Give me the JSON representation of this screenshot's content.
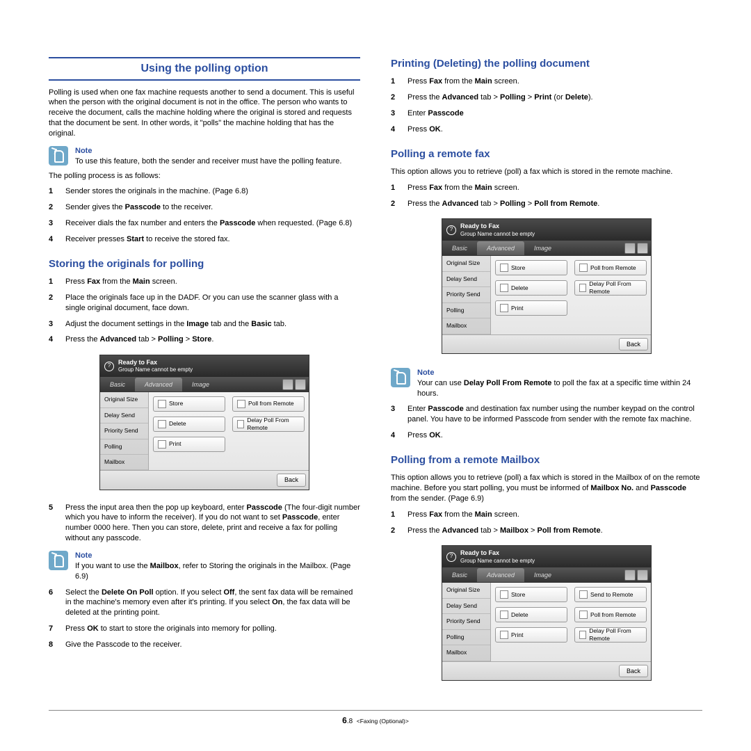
{
  "left": {
    "h1": "Using the polling option",
    "intro": "Polling is used when one fax machine requests another to send a document. This is useful when the person with the original document is not in the office. The person who wants to receive the document, calls the machine holding where the original is stored and requests that the document be sent. In other words, it \"polls\" the machine holding that has the original.",
    "note1_hd": "Note",
    "note1_txt": "To use this feature, both the sender and receiver must have the polling feature.",
    "process_intro": "The polling process is as follows:",
    "proc": {
      "n1": "1",
      "t1_a": "Sender stores the originals in the machine. (Page 6.8)",
      "n2": "2",
      "t2_a": "Sender gives the ",
      "t2_b": "Passcode",
      "t2_c": " to the receiver.",
      "n3": "3",
      "t3_a": "Receiver dials the fax number and enters the ",
      "t3_b": "Passcode",
      "t3_c": " when requested. (Page 6.8)",
      "n4": "4",
      "t4_a": "Receiver presses ",
      "t4_b": "Start",
      "t4_c": " to receive the stored fax."
    },
    "h2a": "Storing the originals for polling",
    "store": {
      "n1": "1",
      "t1_a": "Press ",
      "t1_b": "Fax",
      "t1_c": " from the ",
      "t1_d": "Main",
      "t1_e": " screen.",
      "n2": "2",
      "t2": "Place the originals face up in the DADF. Or you can use the scanner glass with a single original document, face down.",
      "n3": "3",
      "t3_a": "Adjust the document settings in the ",
      "t3_b": "Image",
      "t3_c": " tab and the ",
      "t3_d": "Basic",
      "t3_e": " tab.",
      "n4": "4",
      "t4_a": "Press the ",
      "t4_b": "Advanced",
      "t4_c": " tab > ",
      "t4_d": "Polling",
      "t4_e": " > ",
      "t4_f": "Store",
      "t4_g": ".",
      "n5": "5",
      "t5_a": "Press the input area then the pop up keyboard, enter ",
      "t5_b": "Passcode",
      "t5_c": " (The four-digit number which you have to inform the receiver). If you do not want to set ",
      "t5_d": "Passcode",
      "t5_e": ", enter number 0000 here. Then you can store, delete, print and receive a fax for polling without any passcode.",
      "n6": "6",
      "t6_a": "Select the ",
      "t6_b": "Delete On Poll",
      "t6_c": " option. If you select ",
      "t6_d": "Off",
      "t6_e": ", the sent fax data will be remained in the machine's memory even after it's printing. If you select ",
      "t6_f": "On",
      "t6_g": ", the fax data will be deleted at the printing point.",
      "n7": "7",
      "t7_a": "Press ",
      "t7_b": "OK",
      "t7_c": " to start to store the originals into memory for polling.",
      "n8": "8",
      "t8": "Give the Passcode to the receiver."
    },
    "note2_hd": "Note",
    "note2_a": "If you want to use the ",
    "note2_b": "Mailbox",
    "note2_c": ", refer to Storing the originals in the Mailbox. (Page 6.9)"
  },
  "right": {
    "h2a": "Printing (Deleting) the polling document",
    "pd": {
      "n1": "1",
      "t1_a": "Press ",
      "t1_b": "Fax",
      "t1_c": " from the ",
      "t1_d": "Main",
      "t1_e": " screen.",
      "n2": "2",
      "t2_a": "Press the ",
      "t2_b": "Advanced",
      "t2_c": " tab > ",
      "t2_d": "Polling",
      "t2_e": " > ",
      "t2_f": "Print",
      "t2_g": " (or ",
      "t2_h": "Delete",
      "t2_i": ").",
      "n3": "3",
      "t3_a": "Enter ",
      "t3_b": "Passcode",
      "n4": "4",
      "t4_a": "Press ",
      "t4_b": "OK",
      "t4_c": "."
    },
    "h2b": "Polling a remote fax",
    "prf_intro": "This option allows you to retrieve (poll) a fax which is stored in the remote machine.",
    "prf": {
      "n1": "1",
      "t1_a": "Press ",
      "t1_b": "Fax",
      "t1_c": " from the ",
      "t1_d": "Main",
      "t1_e": " screen.",
      "n2": "2",
      "t2_a": "Press the ",
      "t2_b": "Advanced",
      "t2_c": " tab > ",
      "t2_d": "Polling",
      "t2_e": " > ",
      "t2_f": "Poll from Remote",
      "t2_g": ".",
      "n3": "3",
      "t3_a": "Enter ",
      "t3_b": "Passcode",
      "t3_c": " and destination fax number using the number keypad on the control panel. You have to be informed Passcode from sender with the remote fax machine.",
      "n4": "4",
      "t4_a": "Press ",
      "t4_b": "OK",
      "t4_c": "."
    },
    "note3_hd": "Note",
    "note3_a": "Your can use ",
    "note3_b": "Delay Poll From Remote",
    "note3_c": " to poll the fax at a specific time within 24 hours.",
    "h2c": "Polling from a remote Mailbox",
    "pmb_intro_a": "This option allows you to retrieve (poll) a fax which is stored in the Mailbox of on the remote machine. Before you start polling, you must be informed of ",
    "pmb_intro_b": "Mailbox No.",
    "pmb_intro_c": " and ",
    "pmb_intro_d": "Passcode",
    "pmb_intro_e": " from the sender. (Page 6.9)",
    "pmb": {
      "n1": "1",
      "t1_a": "Press ",
      "t1_b": "Fax",
      "t1_c": " from the ",
      "t1_d": "Main",
      "t1_e": " screen.",
      "n2": "2",
      "t2_a": "Press the ",
      "t2_b": "Advanced",
      "t2_c": " tab > ",
      "t2_d": "Mailbox",
      "t2_e": " > ",
      "t2_f": "Poll from Remote",
      "t2_g": "."
    }
  },
  "shot": {
    "ready": "Ready to Fax",
    "sub": "Group Name cannot be empty",
    "tab1": "Basic",
    "tab2": "Advanced",
    "tab3": "Image",
    "s1": "Original Size",
    "s2": "Delay Send",
    "s3": "Priority Send",
    "s4": "Polling",
    "s5": "Mailbox",
    "a_store": "Store",
    "a_delete": "Delete",
    "a_print": "Print",
    "a_pfr": "Poll from Remote",
    "a_dpfr": "Delay Poll From Remote",
    "b_store": "Store",
    "b_delete": "Delete",
    "b_print": "Print",
    "b_str": "Send to Remote",
    "b_pfr": "Poll from Remote",
    "b_dpfr": "Delay Poll From Remote",
    "back": "Back"
  },
  "footer": {
    "pg": "6",
    "sub": ".8",
    "chap": "<Faxing (Optional)>"
  }
}
